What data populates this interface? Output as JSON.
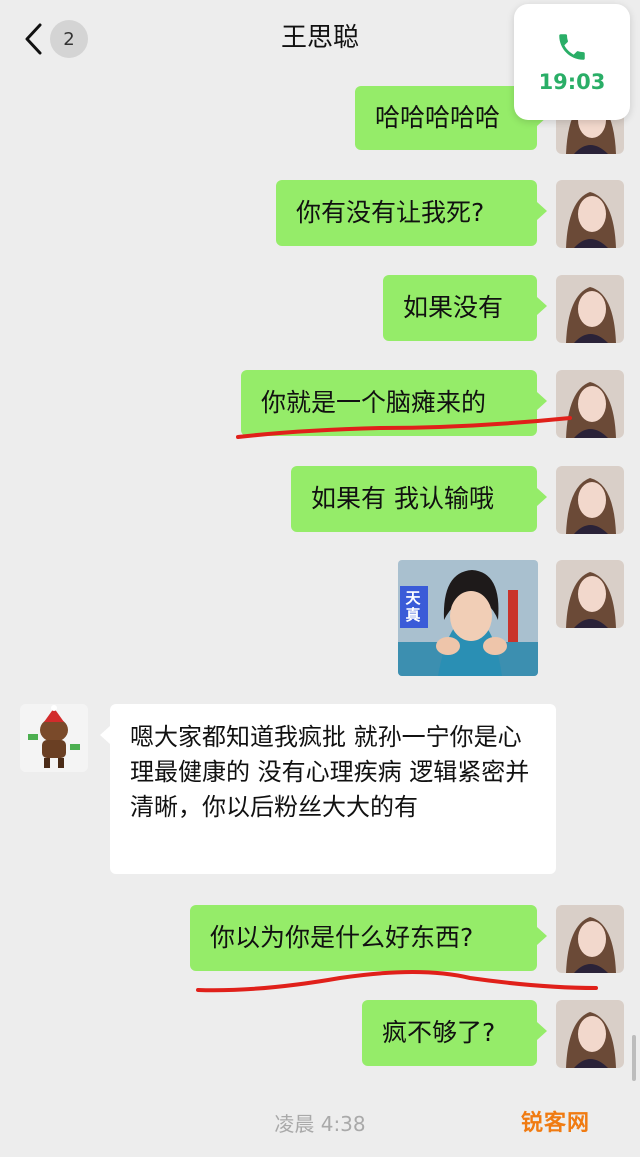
{
  "header": {
    "back_count": "2",
    "contact_name": "王思聪"
  },
  "call": {
    "duration": "19:03",
    "icon": "phone-icon",
    "color": "#2aae67"
  },
  "messages": [
    {
      "side": "out",
      "text": "哈哈哈哈哈"
    },
    {
      "side": "out",
      "text": "你有没有让我死?"
    },
    {
      "side": "out",
      "text": "如果没有"
    },
    {
      "side": "out",
      "text": "你就是一个脑瘫来的"
    },
    {
      "side": "out",
      "text": "如果有 我认输哦"
    },
    {
      "side": "out",
      "type": "sticker",
      "text": "天真"
    },
    {
      "side": "in",
      "text": "嗯大家都知道我疯批 就孙一宁你是心理最健康的 没有心理疾病 逻辑紧密并清晰，你以后粉丝大大的有"
    },
    {
      "side": "out",
      "text": "你以为你是什么好东西?"
    },
    {
      "side": "out",
      "text": "疯不够了?"
    }
  ],
  "timestamp": "凌晨 4:38",
  "watermark": "锐客网",
  "colors": {
    "outgoing_bubble": "#95ec69",
    "incoming_bubble": "#ffffff",
    "background": "#ededed",
    "annotation": "#e0201a"
  }
}
